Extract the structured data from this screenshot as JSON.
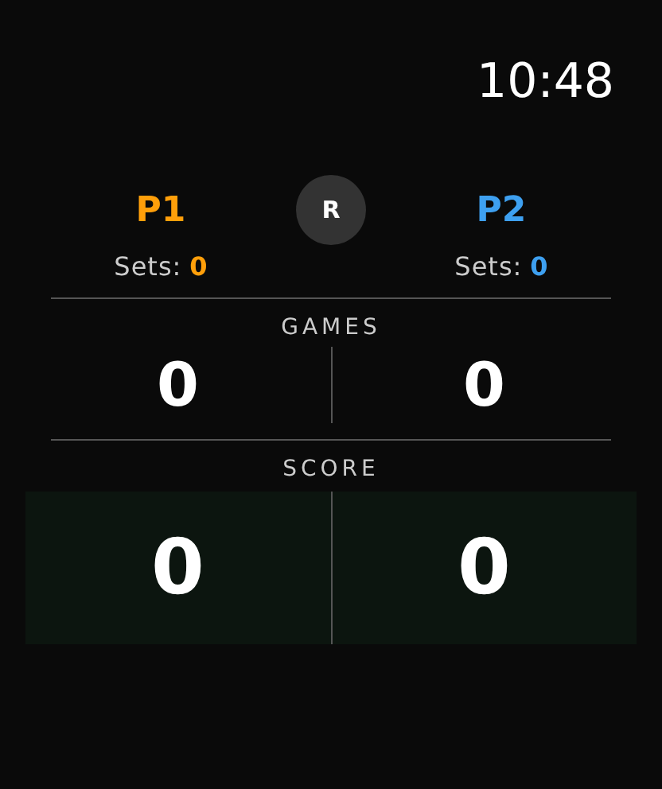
{
  "time": "10:48",
  "players": [
    {
      "name": "P1",
      "color": "#ff9f0a",
      "sets_label": "Sets:",
      "sets": "0"
    },
    {
      "name": "P2",
      "color": "#3ea0f0",
      "sets_label": "Sets:",
      "sets": "0"
    }
  ],
  "reset_button": "R",
  "games": {
    "label": "GAMES",
    "values": [
      "0",
      "0"
    ]
  },
  "score": {
    "label": "SCORE",
    "values": [
      "0",
      "0"
    ]
  }
}
